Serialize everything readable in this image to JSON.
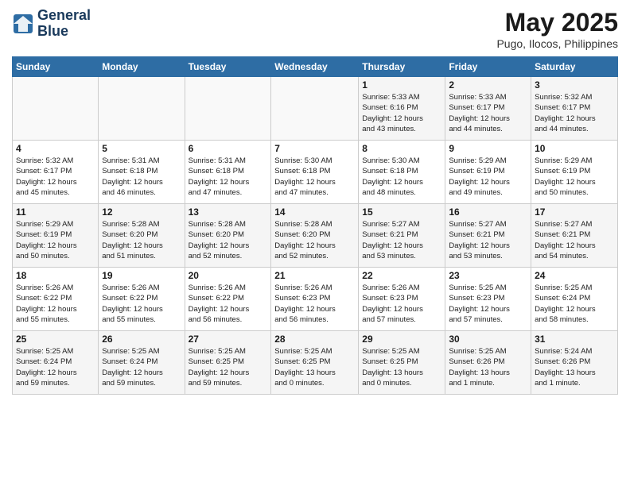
{
  "header": {
    "logo_line1": "General",
    "logo_line2": "Blue",
    "month": "May 2025",
    "location": "Pugo, Ilocos, Philippines"
  },
  "weekdays": [
    "Sunday",
    "Monday",
    "Tuesday",
    "Wednesday",
    "Thursday",
    "Friday",
    "Saturday"
  ],
  "weeks": [
    [
      {
        "day": "",
        "info": ""
      },
      {
        "day": "",
        "info": ""
      },
      {
        "day": "",
        "info": ""
      },
      {
        "day": "",
        "info": ""
      },
      {
        "day": "1",
        "info": "Sunrise: 5:33 AM\nSunset: 6:16 PM\nDaylight: 12 hours\nand 43 minutes."
      },
      {
        "day": "2",
        "info": "Sunrise: 5:33 AM\nSunset: 6:17 PM\nDaylight: 12 hours\nand 44 minutes."
      },
      {
        "day": "3",
        "info": "Sunrise: 5:32 AM\nSunset: 6:17 PM\nDaylight: 12 hours\nand 44 minutes."
      }
    ],
    [
      {
        "day": "4",
        "info": "Sunrise: 5:32 AM\nSunset: 6:17 PM\nDaylight: 12 hours\nand 45 minutes."
      },
      {
        "day": "5",
        "info": "Sunrise: 5:31 AM\nSunset: 6:18 PM\nDaylight: 12 hours\nand 46 minutes."
      },
      {
        "day": "6",
        "info": "Sunrise: 5:31 AM\nSunset: 6:18 PM\nDaylight: 12 hours\nand 47 minutes."
      },
      {
        "day": "7",
        "info": "Sunrise: 5:30 AM\nSunset: 6:18 PM\nDaylight: 12 hours\nand 47 minutes."
      },
      {
        "day": "8",
        "info": "Sunrise: 5:30 AM\nSunset: 6:18 PM\nDaylight: 12 hours\nand 48 minutes."
      },
      {
        "day": "9",
        "info": "Sunrise: 5:29 AM\nSunset: 6:19 PM\nDaylight: 12 hours\nand 49 minutes."
      },
      {
        "day": "10",
        "info": "Sunrise: 5:29 AM\nSunset: 6:19 PM\nDaylight: 12 hours\nand 50 minutes."
      }
    ],
    [
      {
        "day": "11",
        "info": "Sunrise: 5:29 AM\nSunset: 6:19 PM\nDaylight: 12 hours\nand 50 minutes."
      },
      {
        "day": "12",
        "info": "Sunrise: 5:28 AM\nSunset: 6:20 PM\nDaylight: 12 hours\nand 51 minutes."
      },
      {
        "day": "13",
        "info": "Sunrise: 5:28 AM\nSunset: 6:20 PM\nDaylight: 12 hours\nand 52 minutes."
      },
      {
        "day": "14",
        "info": "Sunrise: 5:28 AM\nSunset: 6:20 PM\nDaylight: 12 hours\nand 52 minutes."
      },
      {
        "day": "15",
        "info": "Sunrise: 5:27 AM\nSunset: 6:21 PM\nDaylight: 12 hours\nand 53 minutes."
      },
      {
        "day": "16",
        "info": "Sunrise: 5:27 AM\nSunset: 6:21 PM\nDaylight: 12 hours\nand 53 minutes."
      },
      {
        "day": "17",
        "info": "Sunrise: 5:27 AM\nSunset: 6:21 PM\nDaylight: 12 hours\nand 54 minutes."
      }
    ],
    [
      {
        "day": "18",
        "info": "Sunrise: 5:26 AM\nSunset: 6:22 PM\nDaylight: 12 hours\nand 55 minutes."
      },
      {
        "day": "19",
        "info": "Sunrise: 5:26 AM\nSunset: 6:22 PM\nDaylight: 12 hours\nand 55 minutes."
      },
      {
        "day": "20",
        "info": "Sunrise: 5:26 AM\nSunset: 6:22 PM\nDaylight: 12 hours\nand 56 minutes."
      },
      {
        "day": "21",
        "info": "Sunrise: 5:26 AM\nSunset: 6:23 PM\nDaylight: 12 hours\nand 56 minutes."
      },
      {
        "day": "22",
        "info": "Sunrise: 5:26 AM\nSunset: 6:23 PM\nDaylight: 12 hours\nand 57 minutes."
      },
      {
        "day": "23",
        "info": "Sunrise: 5:25 AM\nSunset: 6:23 PM\nDaylight: 12 hours\nand 57 minutes."
      },
      {
        "day": "24",
        "info": "Sunrise: 5:25 AM\nSunset: 6:24 PM\nDaylight: 12 hours\nand 58 minutes."
      }
    ],
    [
      {
        "day": "25",
        "info": "Sunrise: 5:25 AM\nSunset: 6:24 PM\nDaylight: 12 hours\nand 59 minutes."
      },
      {
        "day": "26",
        "info": "Sunrise: 5:25 AM\nSunset: 6:24 PM\nDaylight: 12 hours\nand 59 minutes."
      },
      {
        "day": "27",
        "info": "Sunrise: 5:25 AM\nSunset: 6:25 PM\nDaylight: 12 hours\nand 59 minutes."
      },
      {
        "day": "28",
        "info": "Sunrise: 5:25 AM\nSunset: 6:25 PM\nDaylight: 13 hours\nand 0 minutes."
      },
      {
        "day": "29",
        "info": "Sunrise: 5:25 AM\nSunset: 6:25 PM\nDaylight: 13 hours\nand 0 minutes."
      },
      {
        "day": "30",
        "info": "Sunrise: 5:25 AM\nSunset: 6:26 PM\nDaylight: 13 hours\nand 1 minute."
      },
      {
        "day": "31",
        "info": "Sunrise: 5:24 AM\nSunset: 6:26 PM\nDaylight: 13 hours\nand 1 minute."
      }
    ]
  ]
}
